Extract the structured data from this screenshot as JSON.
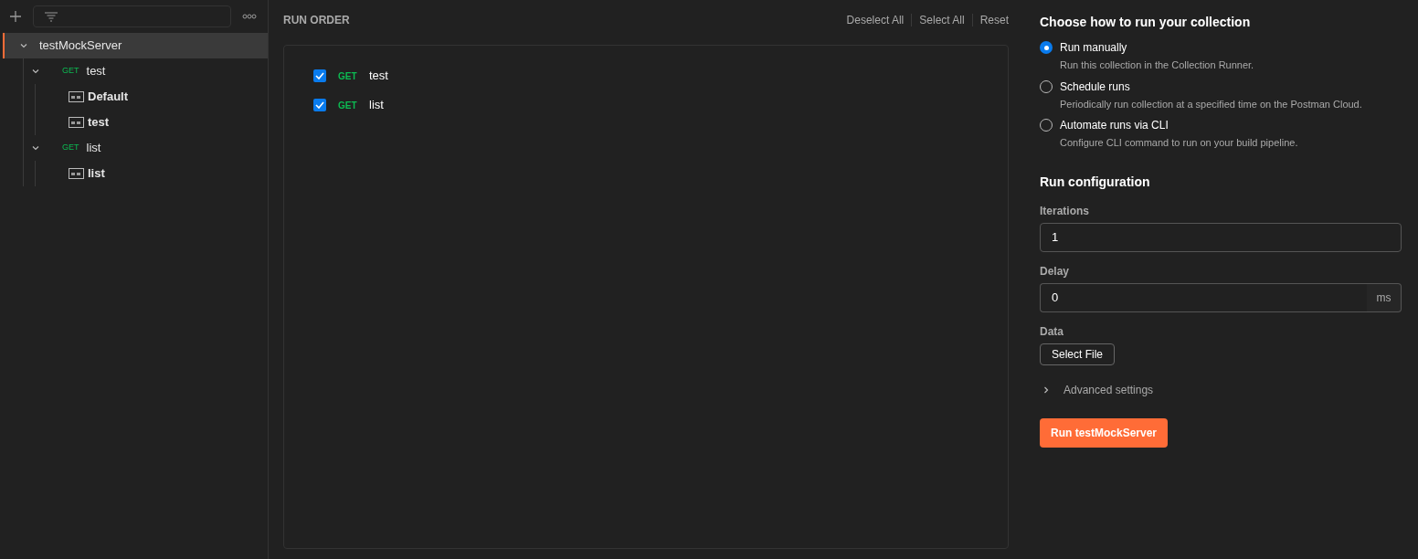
{
  "sidebar": {
    "tree": [
      {
        "kind": "collection",
        "label": "testMockServer",
        "selected": true,
        "expanded": true,
        "children": [
          {
            "kind": "request",
            "method": "GET",
            "label": "test",
            "selected": false,
            "expanded": true,
            "children": [
              {
                "kind": "example",
                "label": "Default",
                "selected": false
              },
              {
                "kind": "example",
                "label": "test",
                "selected": false
              }
            ]
          },
          {
            "kind": "request",
            "method": "GET",
            "label": "list",
            "selected": false,
            "expanded": true,
            "children": [
              {
                "kind": "example",
                "label": "list",
                "selected": false
              }
            ]
          }
        ]
      }
    ]
  },
  "run_order": {
    "title": "RUN ORDER",
    "actions": [
      "Deselect All",
      "Select All",
      "Reset"
    ],
    "items": [
      {
        "method": "GET",
        "label": "test",
        "checked": true
      },
      {
        "method": "GET",
        "label": "list",
        "checked": true
      }
    ]
  },
  "config": {
    "title": "Choose how to run your collection",
    "options": [
      {
        "label": "Run manually",
        "description": "Run this collection in the Collection Runner.",
        "selected": true
      },
      {
        "label": "Schedule runs",
        "description": "Periodically run collection at a specified time on the Postman Cloud.",
        "selected": false
      },
      {
        "label": "Automate runs via CLI",
        "description": "Configure CLI command to run on your build pipeline.",
        "selected": false
      }
    ],
    "section_title": "Run configuration",
    "iterations": {
      "label": "Iterations",
      "value": "1"
    },
    "delay": {
      "label": "Delay",
      "value": "0",
      "unit": "ms"
    },
    "data": {
      "label": "Data",
      "button": "Select File"
    },
    "advanced": {
      "label": "Advanced settings",
      "expanded": false
    },
    "run_button": "Run testMockServer"
  }
}
